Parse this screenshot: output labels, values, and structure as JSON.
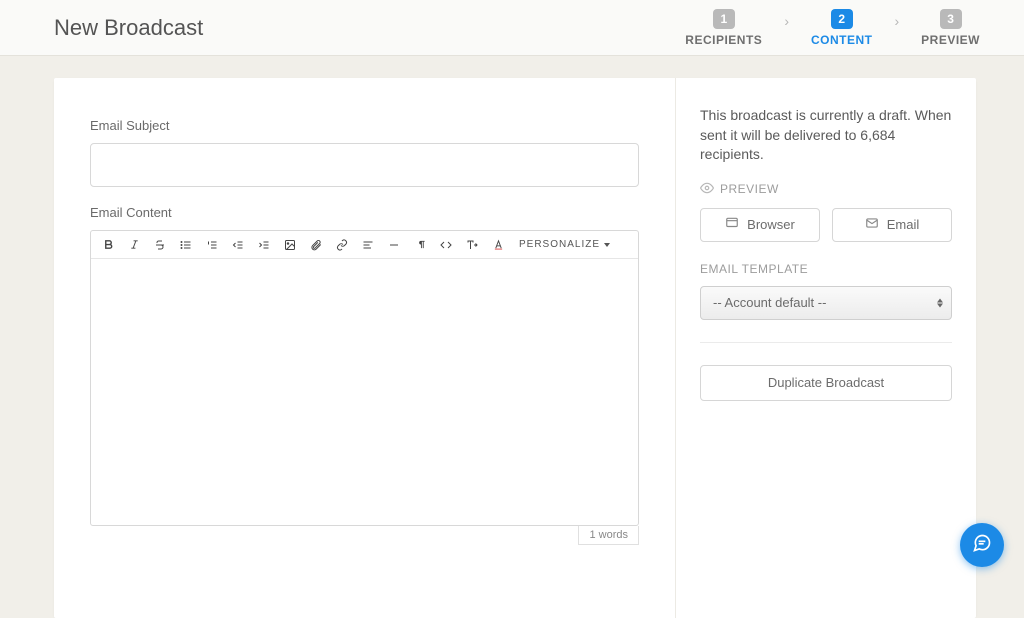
{
  "page": {
    "title": "New Broadcast"
  },
  "steps": [
    {
      "num": "1",
      "label": "RECIPIENTS"
    },
    {
      "num": "2",
      "label": "CONTENT"
    },
    {
      "num": "3",
      "label": "PREVIEW"
    }
  ],
  "active_step_index": 1,
  "form": {
    "subject_label": "Email Subject",
    "subject_value": "",
    "content_label": "Email Content",
    "content_value": "",
    "word_count": "1 words",
    "personalize_label": "PERSONALIZE"
  },
  "sidebar": {
    "draft_note": "This broadcast is currently a draft. When sent it will be delivered to 6,684 recipients.",
    "preview_heading": "PREVIEW",
    "browser_label": "Browser",
    "email_label": "Email",
    "template_heading": "EMAIL TEMPLATE",
    "template_selected": "-- Account default --",
    "duplicate_label": "Duplicate Broadcast"
  }
}
